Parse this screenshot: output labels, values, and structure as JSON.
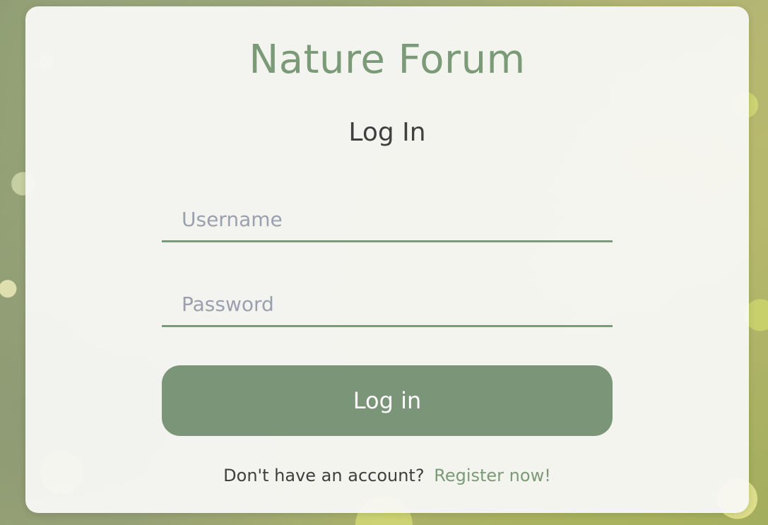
{
  "app": {
    "title": "Nature Forum"
  },
  "login": {
    "heading": "Log In",
    "username_placeholder": "Username",
    "password_placeholder": "Password",
    "submit_label": "Log in",
    "register_prompt": "Don't have an account?",
    "register_link": "Register now!"
  },
  "colors": {
    "accent": "#7B9A77",
    "button": "#7B9578",
    "heading_text": "#3F3F3F",
    "placeholder": "#9AA0AE"
  }
}
